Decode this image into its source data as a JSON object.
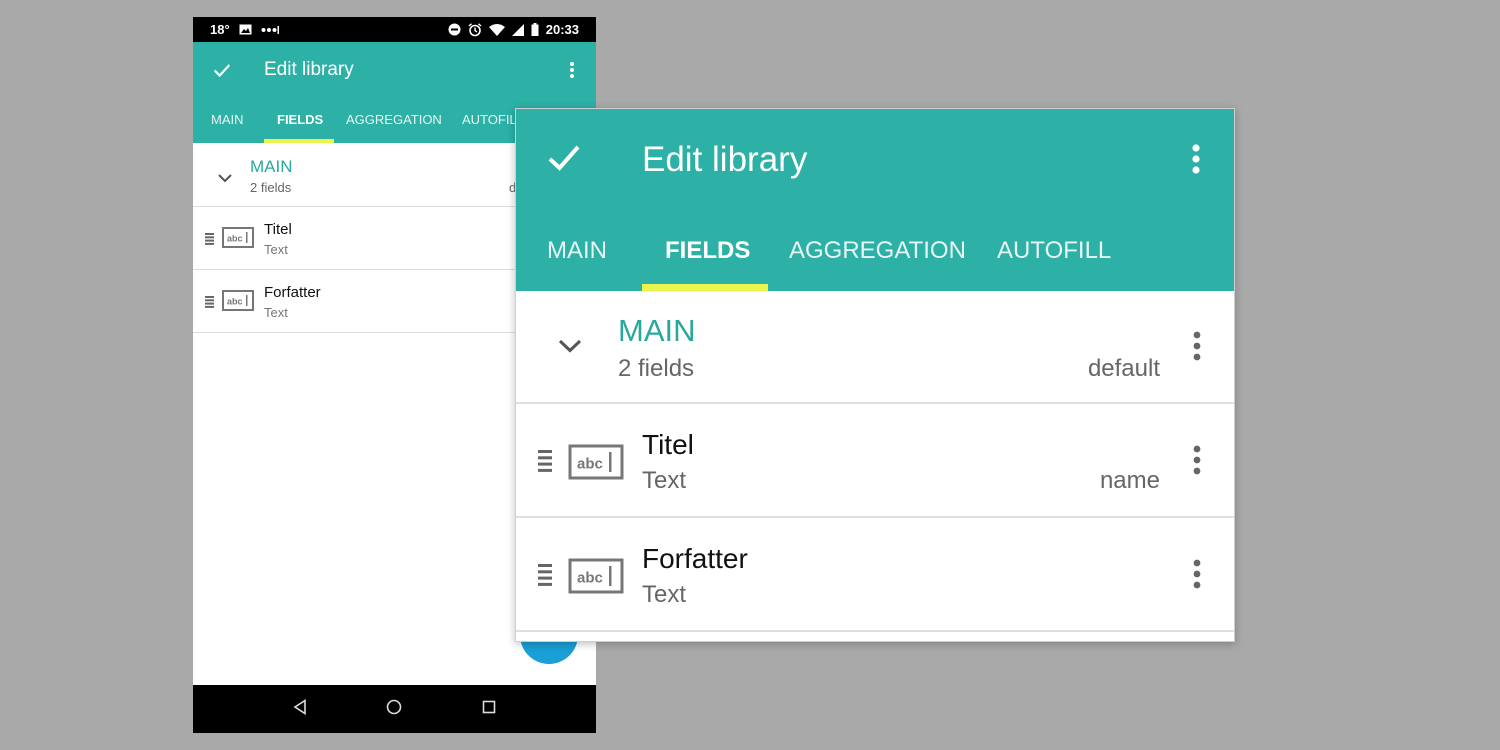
{
  "status_bar": {
    "temperature": "18°",
    "time": "20:33"
  },
  "toolbar": {
    "title": "Edit library",
    "confirm_icon": "check-icon",
    "menu_icon": "more-vert-icon"
  },
  "tabs": [
    {
      "label": "MAIN",
      "active": false
    },
    {
      "label": "FIELDS",
      "active": true
    },
    {
      "label": "AGGREGATION",
      "active": false
    },
    {
      "label": "AUTOFILL",
      "active": false
    }
  ],
  "phone_partial_tab": "AUTOFIL",
  "phone_partial_default": "d",
  "group": {
    "name": "MAIN",
    "count": "2 fields",
    "tag": "default"
  },
  "fields": [
    {
      "name": "Titel",
      "type": "Text",
      "key": "name"
    },
    {
      "name": "Forfatter",
      "type": "Text",
      "key": ""
    }
  ],
  "field_icon_text": "abc",
  "colors": {
    "primary": "#2db0a6",
    "accent": "#e9f54a",
    "group_title": "#2aa89d",
    "fab": "#1a9fd6"
  }
}
